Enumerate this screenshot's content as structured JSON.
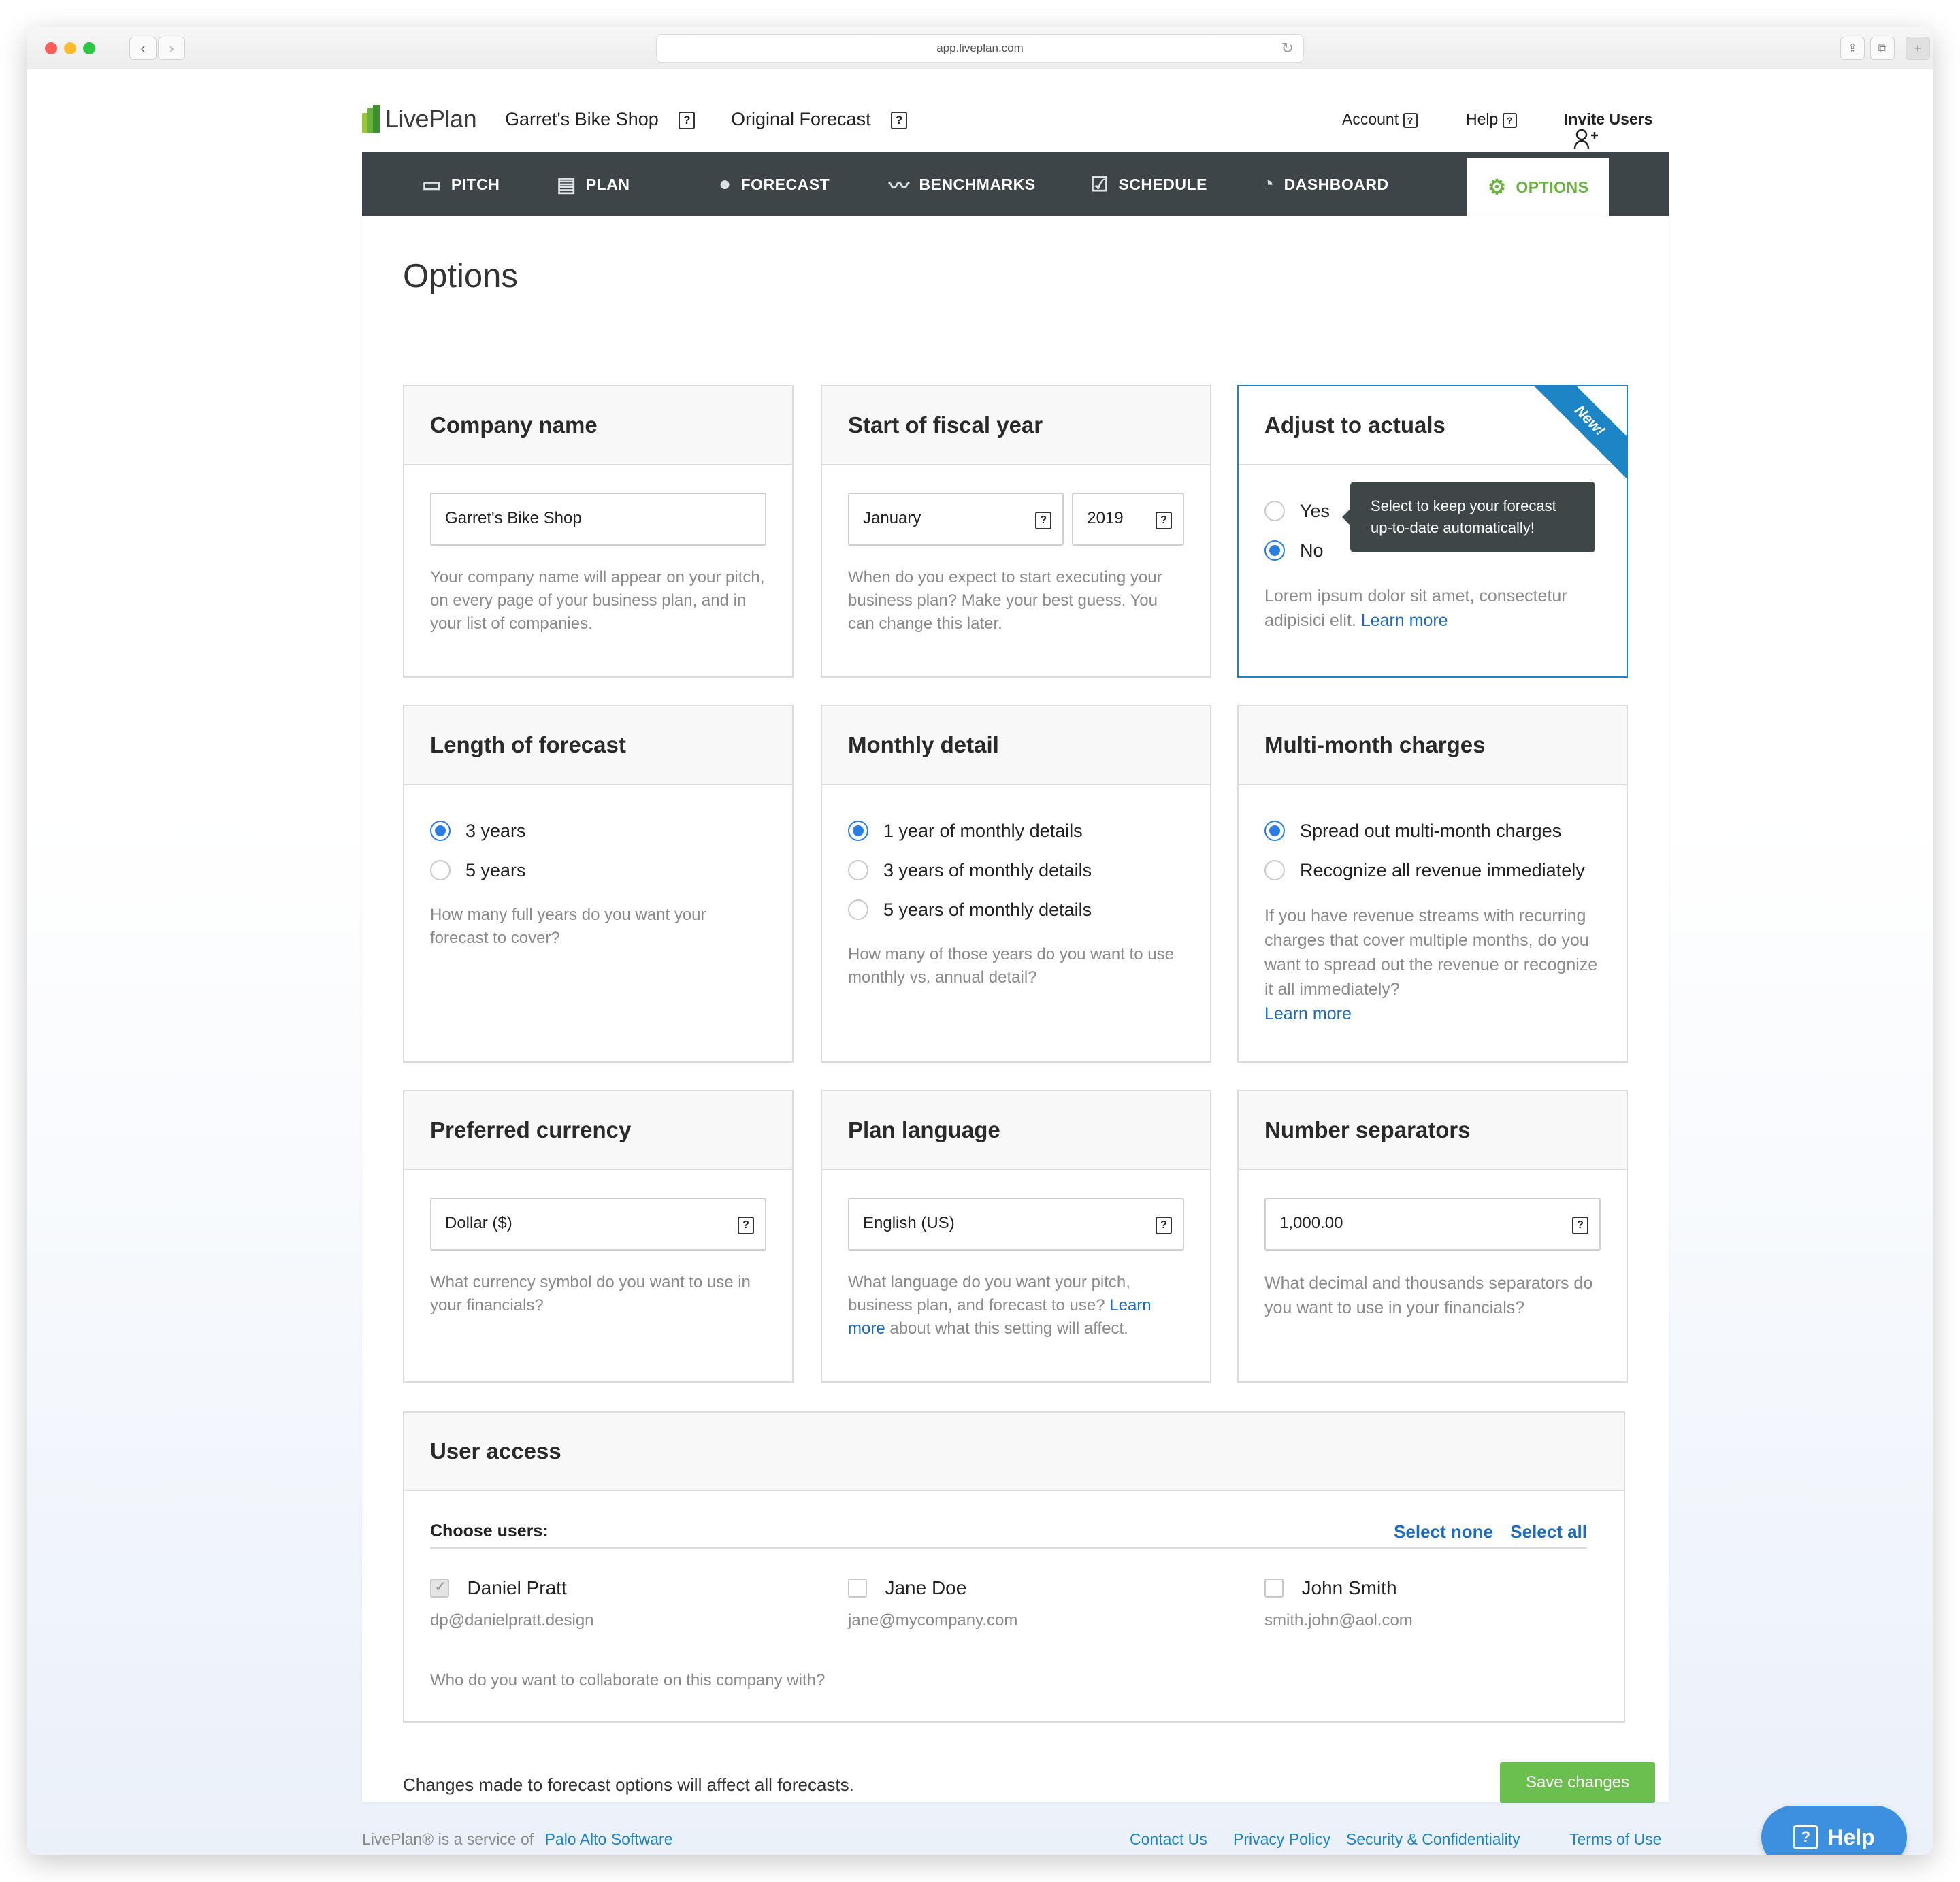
{
  "browser": {
    "url": "app.liveplan.com"
  },
  "colors": {
    "accent_green": "#6ab23e",
    "link_blue": "#1d6bbd",
    "nav_dark": "#3e4548",
    "radio_blue": "#2a7de1"
  },
  "topbar": {
    "logo": "LivePlan",
    "company": "Garret's Bike Shop",
    "forecast": "Original Forecast",
    "account": "Account",
    "help": "Help",
    "invite": "Invite Users"
  },
  "nav": {
    "tabs": [
      {
        "label": "PITCH",
        "icon": "monitor-icon"
      },
      {
        "label": "PLAN",
        "icon": "document-icon"
      },
      {
        "label": "FORECAST",
        "icon": "piggy-bank-icon"
      },
      {
        "label": "BENCHMARKS",
        "icon": "trend-icon"
      },
      {
        "label": "SCHEDULE",
        "icon": "checkbox-icon"
      },
      {
        "label": "DASHBOARD",
        "icon": "gauge-icon"
      },
      {
        "label": "OPTIONS",
        "icon": "gear-icon",
        "active": true
      }
    ]
  },
  "page": {
    "title": "Options"
  },
  "cards": {
    "company": {
      "title": "Company name",
      "value": "Garret's Bike Shop",
      "help": "Your company name will appear on your pitch, on every page of your business plan, and in your list of companies."
    },
    "fiscal": {
      "title": "Start of fiscal year",
      "month": "January",
      "year": "2019",
      "help": "When do you expect to start executing your business plan? Make your best guess. You can change this later."
    },
    "actuals": {
      "title": "Adjust to actuals",
      "badge": "New!",
      "options": [
        "Yes",
        "No"
      ],
      "selected": "No",
      "tooltip": "Select to keep your forecast up-to-date automatically!",
      "help": "Lorem ipsum dolor sit amet, consectetur adipisici elit.",
      "link": "Learn more"
    },
    "length": {
      "title": "Length of forecast",
      "options": [
        "3 years",
        "5 years"
      ],
      "selected": "3 years",
      "help": "How many full years do you want your forecast to cover?"
    },
    "monthly": {
      "title": "Monthly detail",
      "options": [
        "1 year of monthly details",
        "3 years of monthly details",
        "5 years of monthly details"
      ],
      "selected": "1 year of monthly details",
      "help": "How many of those years do you want to use monthly vs. annual detail?"
    },
    "multimonth": {
      "title": "Multi-month charges",
      "options": [
        "Spread out multi-month charges",
        "Recognize all revenue immediately"
      ],
      "selected": "Spread out multi-month charges",
      "help": "If you have revenue streams with recurring charges that cover multiple months, do you want to spread out the revenue or recognize it all immediately?",
      "link": "Learn more"
    },
    "currency": {
      "title": "Preferred currency",
      "value": "Dollar ($)",
      "help": "What currency symbol do you want to use in your financials?"
    },
    "language": {
      "title": "Plan language",
      "value": "English (US)",
      "help_pre": "What language do you want your pitch, business plan, and forecast to use?",
      "link": "Learn more",
      "help_post": "about what this setting will affect."
    },
    "separators": {
      "title": "Number separators",
      "value": "1,000.00",
      "help": "What decimal and thousands separators do you want to use in your financials?"
    }
  },
  "user_access": {
    "title": "User access",
    "choose": "Choose users:",
    "select_none": "Select none",
    "select_all": "Select all",
    "users": [
      {
        "name": "Daniel Pratt",
        "email": "dp@danielpratt.design",
        "checked": true
      },
      {
        "name": "Jane Doe",
        "email": "jane@mycompany.com",
        "checked": false
      },
      {
        "name": "John Smith",
        "email": "smith.john@aol.com",
        "checked": false
      }
    ],
    "help": "Who do you want to collaborate on this company with?"
  },
  "footer_note": "Changes made to forecast options will affect all forecasts.",
  "save_label": "Save changes",
  "footer": {
    "service_text": "LivePlan® is a service of",
    "company_link": "Palo Alto Software",
    "links": [
      "Contact Us",
      "Privacy Policy",
      "Security & Confidentiality",
      "Terms of Use"
    ]
  },
  "help_button": "Help"
}
